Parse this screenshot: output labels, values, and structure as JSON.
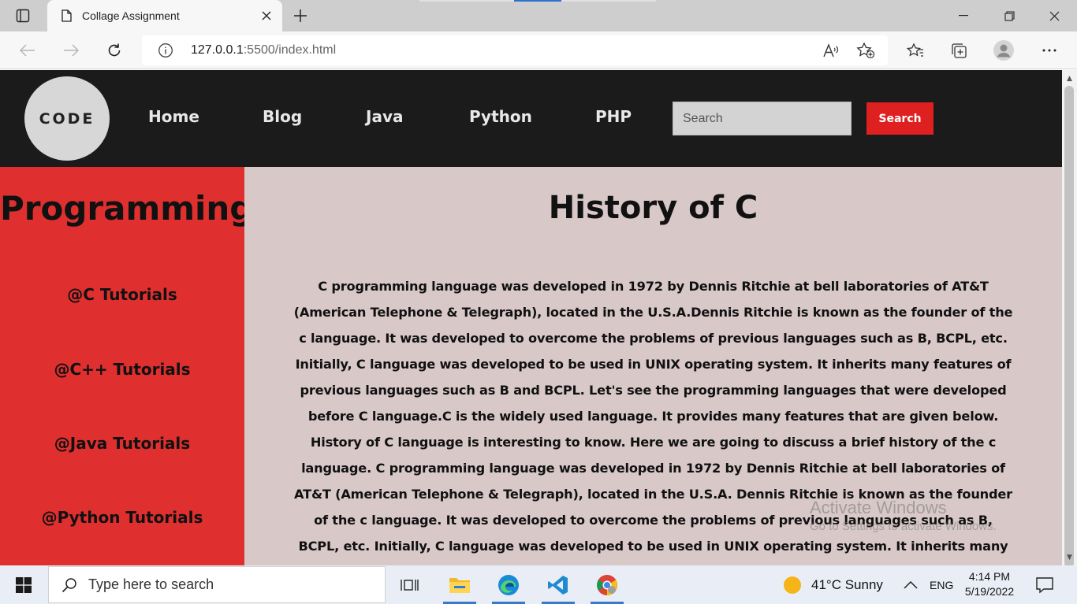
{
  "browser": {
    "tab_title": "Collage Assignment",
    "url_host": "127.0.0.1",
    "url_rest": ":5500/index.html"
  },
  "header": {
    "logo_text": "CODE",
    "nav": [
      "Home",
      "Blog",
      "Java",
      "Python",
      "PHP"
    ],
    "search_placeholder": "Search",
    "search_button": "Search"
  },
  "sidebar": {
    "title": "Programming",
    "links": [
      "@C Tutorials",
      "@C++ Tutorials",
      "@Java Tutorials",
      "@Python Tutorials"
    ]
  },
  "main": {
    "heading": "History of C",
    "body": "C programming language was developed in 1972 by Dennis Ritchie at bell laboratories of AT&T (American Telephone & Telegraph), located in the U.S.A.Dennis Ritchie is known as the founder of the c language. It was developed to overcome the problems of previous languages such as B, BCPL, etc. Initially, C language was developed to be used in UNIX operating system. It inherits many features of previous languages such as B and BCPL. Let's see the programming languages that were developed before C language.C is the widely used language. It provides many features that are given below. History of C language is interesting to know. Here we are going to discuss a brief history of the c language. C programming language was developed in 1972 by Dennis Ritchie at bell laboratories of AT&T (American Telephone & Telegraph), located in the U.S.A. Dennis Ritchie is known as the founder of the c language. It was developed to overcome the problems of previous languages such as B, BCPL, etc. Initially, C language was developed to be used in UNIX operating system. It inherits many features of previous languages such as B and BCPL. Let's see the programming languages that were developed"
  },
  "watermark": {
    "line1": "Activate Windows",
    "line2": "Go to Settings to activate Windows."
  },
  "taskbar": {
    "search_placeholder": "Type here to search",
    "weather": "41°C  Sunny",
    "language": "ENG",
    "time": "4:14 PM",
    "date": "5/19/2022"
  },
  "colors": {
    "header_bg": "#1b1b1b",
    "sidebar_bg": "#df2f2f",
    "content_bg": "#d8c8c8",
    "search_button_bg": "#df2020"
  }
}
